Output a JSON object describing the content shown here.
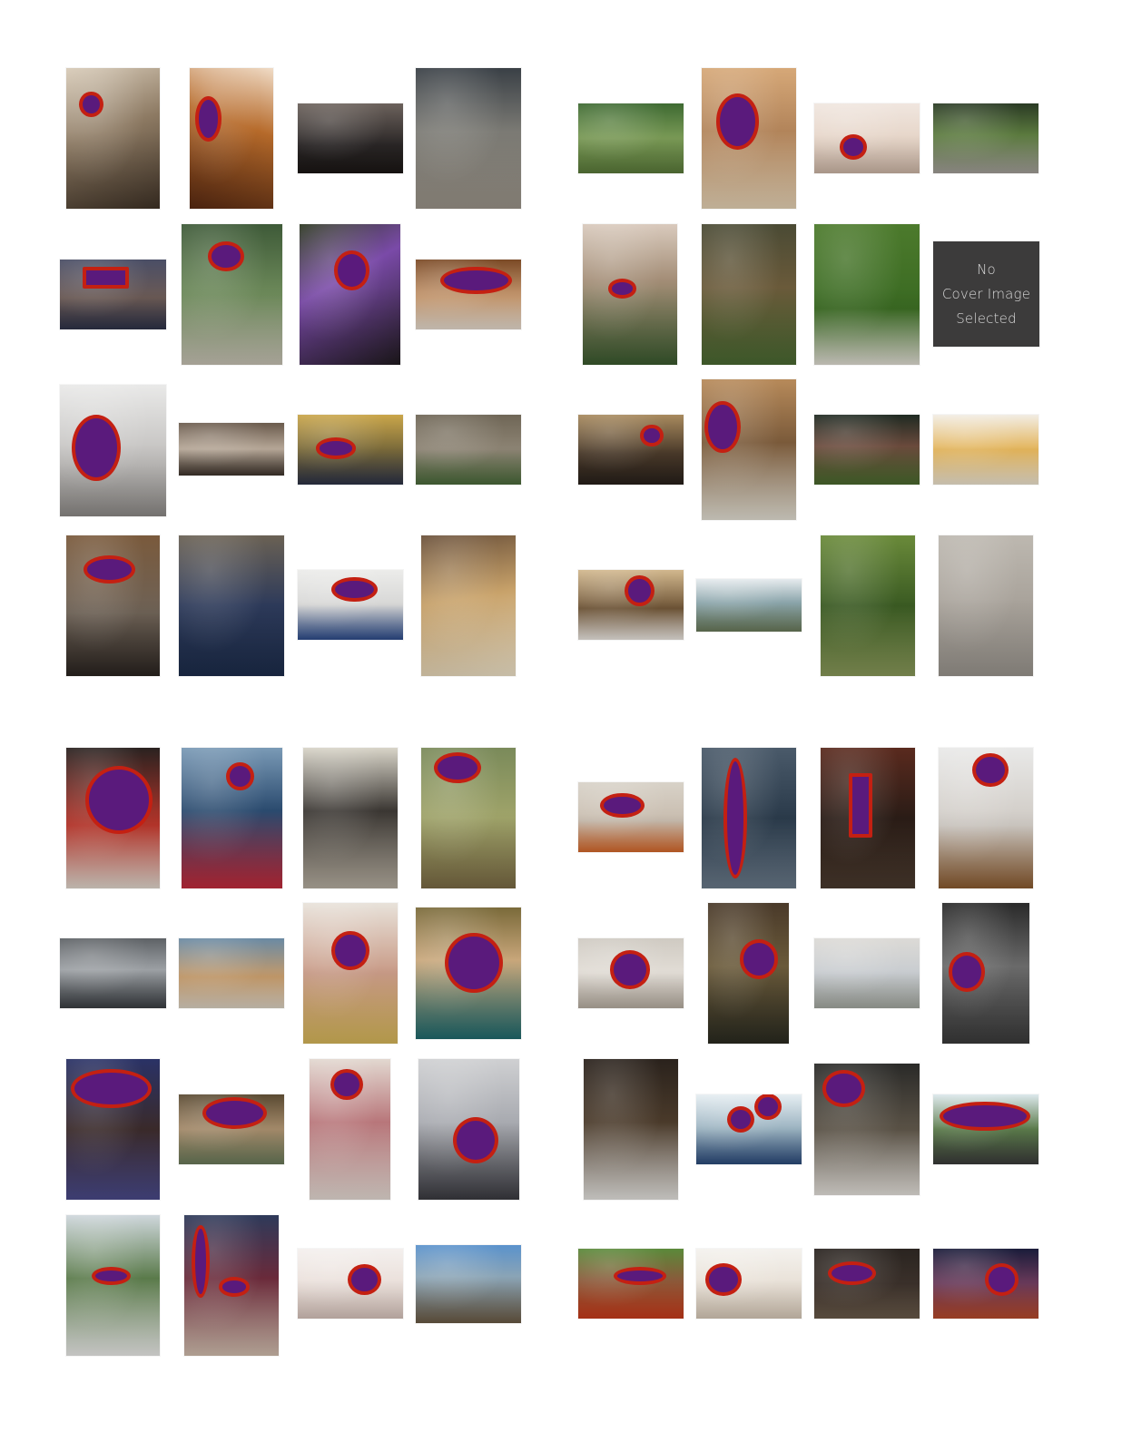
{
  "sheet": {
    "placeholder": {
      "line1": "No",
      "line2": "Cover Image",
      "line3": "Selected"
    }
  }
}
